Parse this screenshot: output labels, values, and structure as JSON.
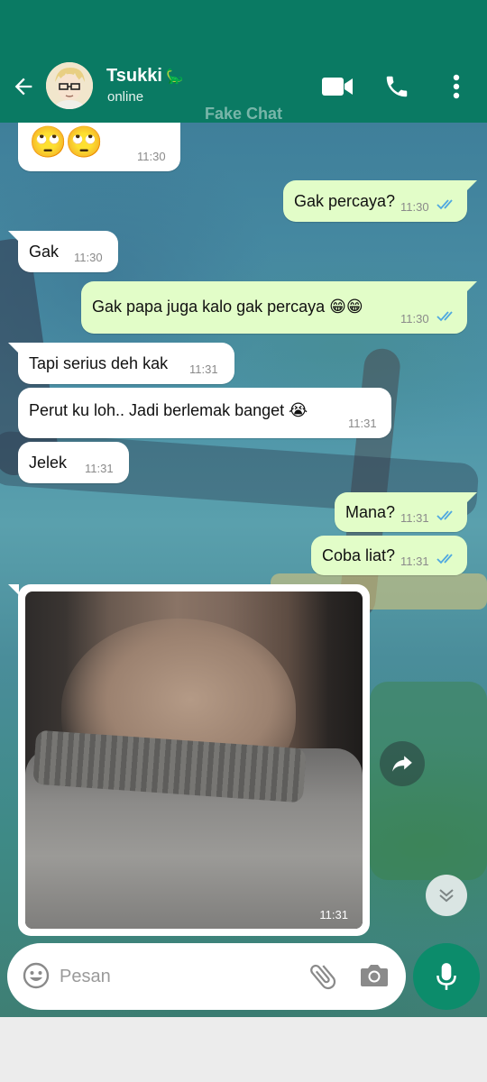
{
  "header": {
    "contact_name": "Tsukki",
    "contact_emoji": "🦕",
    "status": "online",
    "watermark": "Fake Chat"
  },
  "messages": [
    {
      "dir": "in",
      "text": "🙄🙄",
      "time": "11:30"
    },
    {
      "dir": "out",
      "text": "Gak percaya?",
      "time": "11:30",
      "read": true
    },
    {
      "dir": "in",
      "text": "Gak",
      "time": "11:30"
    },
    {
      "dir": "out",
      "text": "Gak papa juga kalo gak percaya 😁😁",
      "time": "11:30",
      "read": true
    },
    {
      "dir": "in",
      "text": "Tapi serius deh kak",
      "time": "11:31"
    },
    {
      "dir": "in",
      "text": "Perut ku loh.. Jadi berlemak banget 😭",
      "time": "11:31"
    },
    {
      "dir": "in",
      "text": "Jelek",
      "time": "11:31"
    },
    {
      "dir": "out",
      "text": "Mana?",
      "time": "11:31",
      "read": true
    },
    {
      "dir": "out",
      "text": "Coba liat?",
      "time": "11:31",
      "read": true
    },
    {
      "dir": "in",
      "type": "photo",
      "time": "11:31"
    }
  ],
  "composer": {
    "placeholder": "Pesan"
  },
  "icons": {
    "back": "arrow-left-icon",
    "video": "video-call-icon",
    "call": "phone-icon",
    "menu": "more-vert-icon",
    "emoji": "emoji-icon",
    "attach": "paperclip-icon",
    "camera": "camera-icon",
    "mic": "mic-icon",
    "forward": "forward-icon",
    "scroll": "chevron-down-icon",
    "read": "double-check-icon"
  },
  "colors": {
    "primary": "#0a7a63",
    "outgoing_bubble": "#e2fdc8",
    "incoming_bubble": "#ffffff",
    "read_ticks": "#4fa8e0",
    "mic_button": "#0c8c6b"
  }
}
